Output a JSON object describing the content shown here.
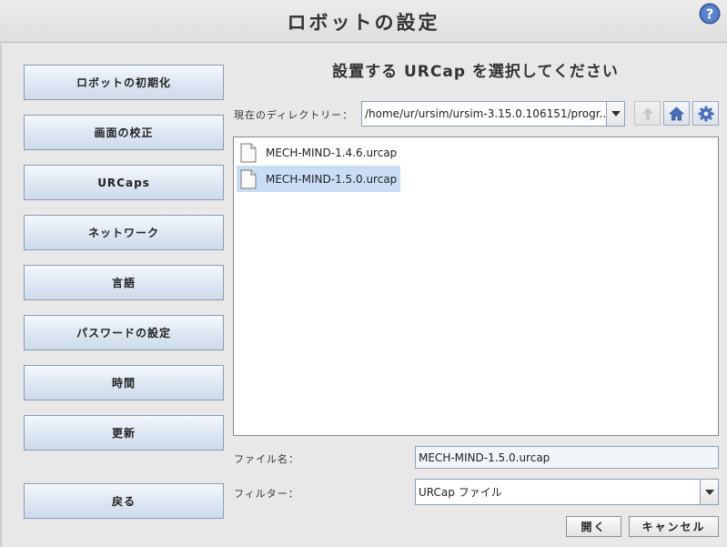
{
  "header": {
    "title": "ロボットの設定",
    "help_icon": "question-circle-icon"
  },
  "sidebar": {
    "items": [
      {
        "label": "ロボットの初期化"
      },
      {
        "label": "画面の校正"
      },
      {
        "label": "URCaps"
      },
      {
        "label": "ネットワーク"
      },
      {
        "label": "言語"
      },
      {
        "label": "パスワードの設定"
      },
      {
        "label": "時間"
      },
      {
        "label": "更新"
      }
    ],
    "back_label": "戻る"
  },
  "dialog": {
    "heading": "設置する URCap を選択してください",
    "directory_label": "現在のディレクトリー：",
    "directory_value": "/home/ur/ursim/ursim-3.15.0.106151/progr...",
    "toolbar_icons": [
      "up-arrow-icon",
      "home-icon",
      "gear-icon"
    ],
    "files": [
      {
        "name": "MECH-MIND-1.4.6.urcap",
        "selected": false
      },
      {
        "name": "MECH-MIND-1.5.0.urcap",
        "selected": true
      }
    ],
    "filename_label": "ファイル名：",
    "filename_value": "MECH-MIND-1.5.0.urcap",
    "filter_label": "フィルター：",
    "filter_value": "URCap ファイル",
    "open_label": "開く",
    "cancel_label": "キャンセル"
  },
  "colors": {
    "accent": "#5a7bbf",
    "selection": "#c9def4",
    "button_border": "#8b9cb4"
  }
}
